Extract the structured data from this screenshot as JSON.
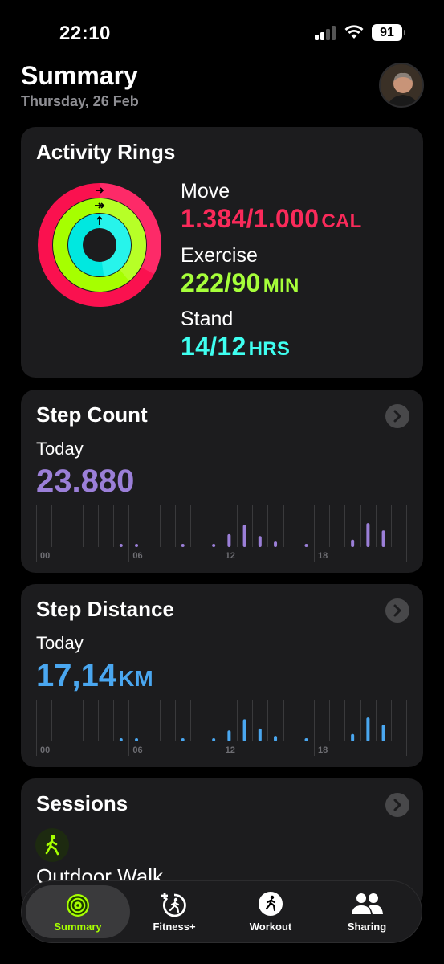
{
  "status_bar": {
    "time": "22:10",
    "battery": "91"
  },
  "header": {
    "title": "Summary",
    "date": "Thursday, 26 Feb"
  },
  "colors": {
    "move": "#fa114f",
    "exercise": "#a6ff00",
    "stand": "#00f5ea",
    "steps": "#9b7fd8",
    "distance": "#4aa7f0"
  },
  "activity_rings": {
    "title": "Activity Rings",
    "move": {
      "label": "Move",
      "value": "1.384/1.000",
      "unit": "CAL"
    },
    "exercise": {
      "label": "Exercise",
      "value": "222/90",
      "unit": "MIN"
    },
    "stand": {
      "label": "Stand",
      "value": "14/12",
      "unit": "HRS"
    }
  },
  "step_count": {
    "title": "Step Count",
    "period": "Today",
    "value": "23.880",
    "axis_labels": [
      "00",
      "06",
      "12",
      "18"
    ],
    "hourly_fraction": [
      0,
      0,
      0,
      0,
      0,
      0.05,
      0.05,
      0,
      0,
      0.05,
      0,
      0.05,
      0.35,
      0.6,
      0.3,
      0.15,
      0,
      0.05,
      0,
      0,
      0.2,
      0.65,
      0.45,
      0
    ]
  },
  "step_distance": {
    "title": "Step Distance",
    "period": "Today",
    "value": "17,14",
    "unit": "KM",
    "axis_labels": [
      "00",
      "06",
      "12",
      "18"
    ],
    "hourly_fraction": [
      0,
      0,
      0,
      0,
      0,
      0.05,
      0.05,
      0,
      0,
      0.05,
      0,
      0.05,
      0.3,
      0.6,
      0.35,
      0.15,
      0,
      0.05,
      0,
      0,
      0.2,
      0.65,
      0.45,
      0
    ]
  },
  "sessions": {
    "title": "Sessions",
    "first_item": "Outdoor Walk"
  },
  "tabs": [
    {
      "label": "Summary",
      "icon": "rings-icon",
      "active": true
    },
    {
      "label": "Fitness+",
      "icon": "fitness-plus-icon",
      "active": false
    },
    {
      "label": "Workout",
      "icon": "workout-runner-icon",
      "active": false
    },
    {
      "label": "Sharing",
      "icon": "sharing-people-icon",
      "active": false
    }
  ]
}
